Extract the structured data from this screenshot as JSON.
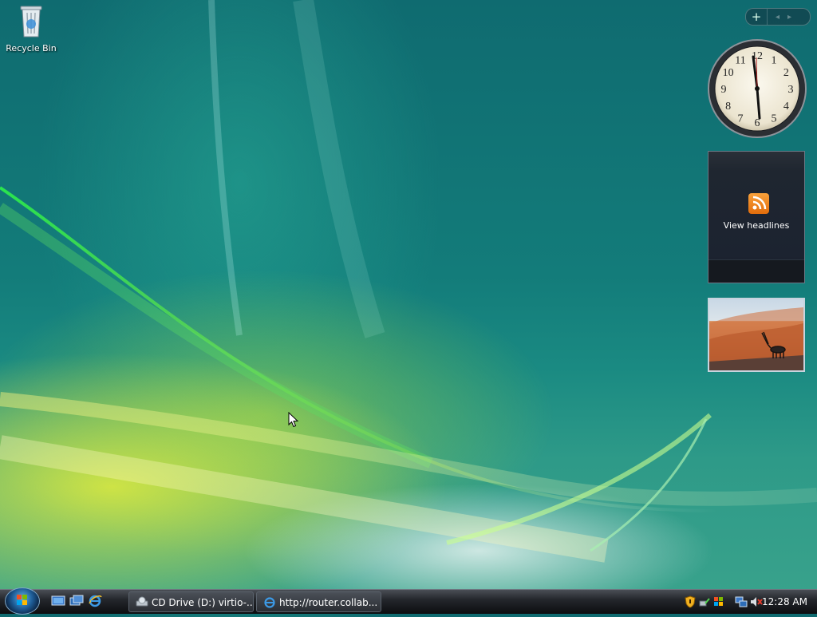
{
  "desktop": {
    "recycle_bin_label": "Recycle Bin"
  },
  "gadgets": {
    "toolbar": {
      "add_label": "+",
      "prev_label": "◂",
      "next_label": "▸"
    },
    "clock": {
      "numerals": [
        "12",
        "1",
        "2",
        "3",
        "4",
        "5",
        "6",
        "7",
        "8",
        "9",
        "10",
        "11"
      ]
    },
    "feed": {
      "label": "View headlines"
    }
  },
  "taskbar": {
    "tasks": [
      {
        "label": "CD Drive (D:) virtio-..."
      },
      {
        "label": "http://router.collab..."
      }
    ],
    "clock_time": "12:28 AM"
  },
  "colors": {
    "taskbar": "#1a1c20",
    "desktop": "#137c7a",
    "rss_orange": "#f28c1f"
  }
}
